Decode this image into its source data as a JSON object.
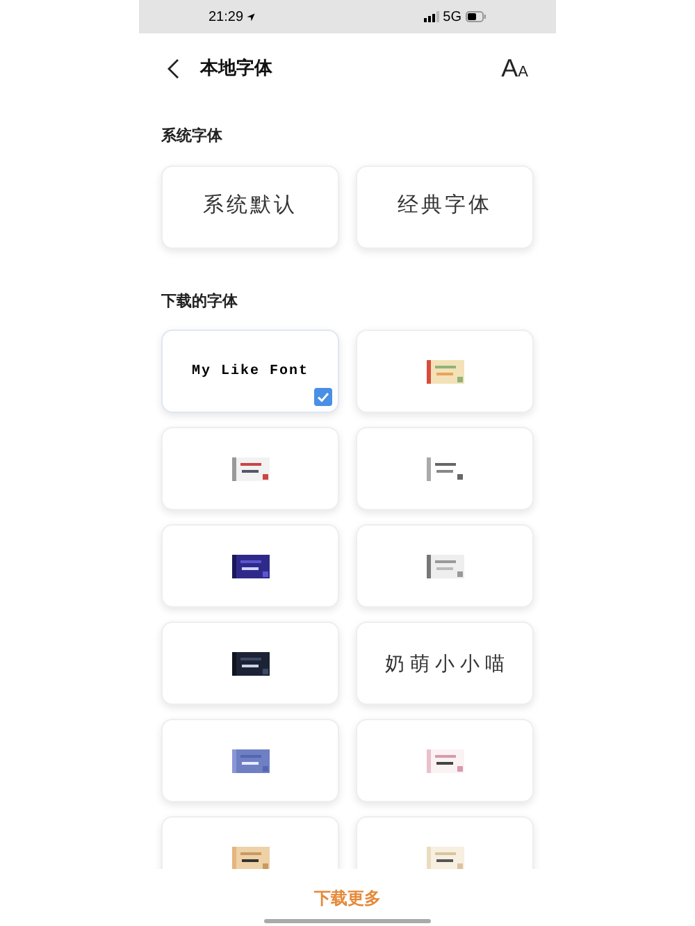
{
  "status_bar": {
    "time": "21:29",
    "network": "5G"
  },
  "header": {
    "title": "本地字体",
    "font_glyph_large": "A",
    "font_glyph_small": "A"
  },
  "system_section": {
    "title": "系统字体",
    "fonts": [
      {
        "label": "系统默认",
        "selected": false
      },
      {
        "label": "经典字体",
        "selected": false
      }
    ]
  },
  "downloaded_section": {
    "title": "下载的字体",
    "fonts": [
      {
        "kind": "text",
        "label": "My Like Font",
        "selected": true
      },
      {
        "kind": "picture",
        "selected": false
      },
      {
        "kind": "picture",
        "selected": false
      },
      {
        "kind": "picture",
        "selected": false
      },
      {
        "kind": "picture",
        "selected": false
      },
      {
        "kind": "picture",
        "selected": false
      },
      {
        "kind": "picture",
        "selected": false
      },
      {
        "kind": "text",
        "label": "奶 萌 小 小 喵",
        "selected": false
      },
      {
        "kind": "picture",
        "selected": false
      },
      {
        "kind": "picture",
        "selected": false
      },
      {
        "kind": "picture",
        "selected": false
      },
      {
        "kind": "picture",
        "selected": false
      }
    ]
  },
  "footer": {
    "button": "下载更多"
  }
}
